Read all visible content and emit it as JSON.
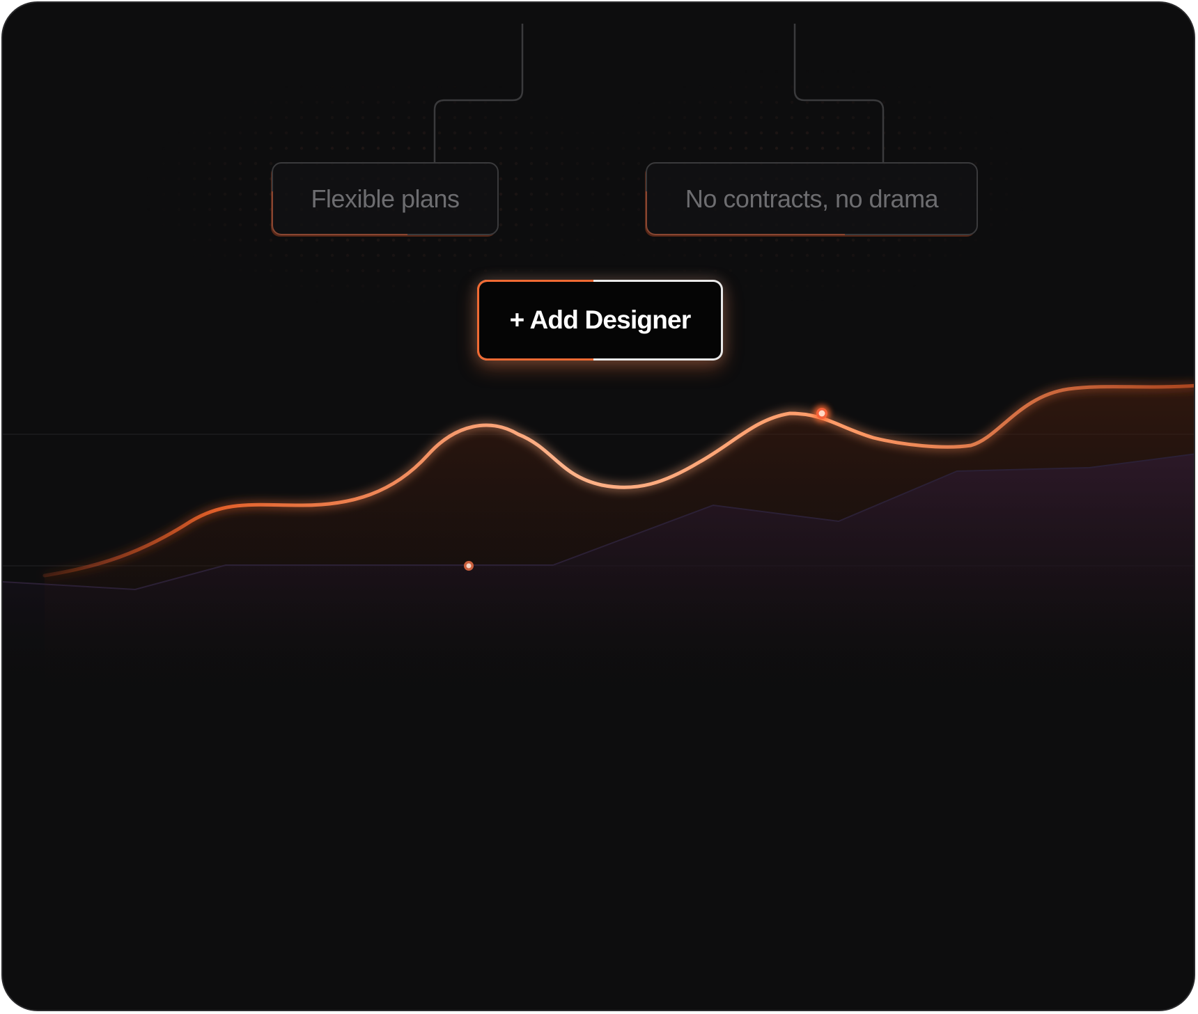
{
  "tags": {
    "flexible": "Flexible plans",
    "contracts": "No contracts, no drama"
  },
  "button": {
    "add_label": "+ Add Designer"
  },
  "colors": {
    "background": "#0d0d0e",
    "accent": "#f06a33",
    "line_glow": "#ff8a4c",
    "secondary_area": "#2a1a2c"
  },
  "icons": {
    "markers": [
      "data-point-marker",
      "data-point-marker"
    ]
  }
}
